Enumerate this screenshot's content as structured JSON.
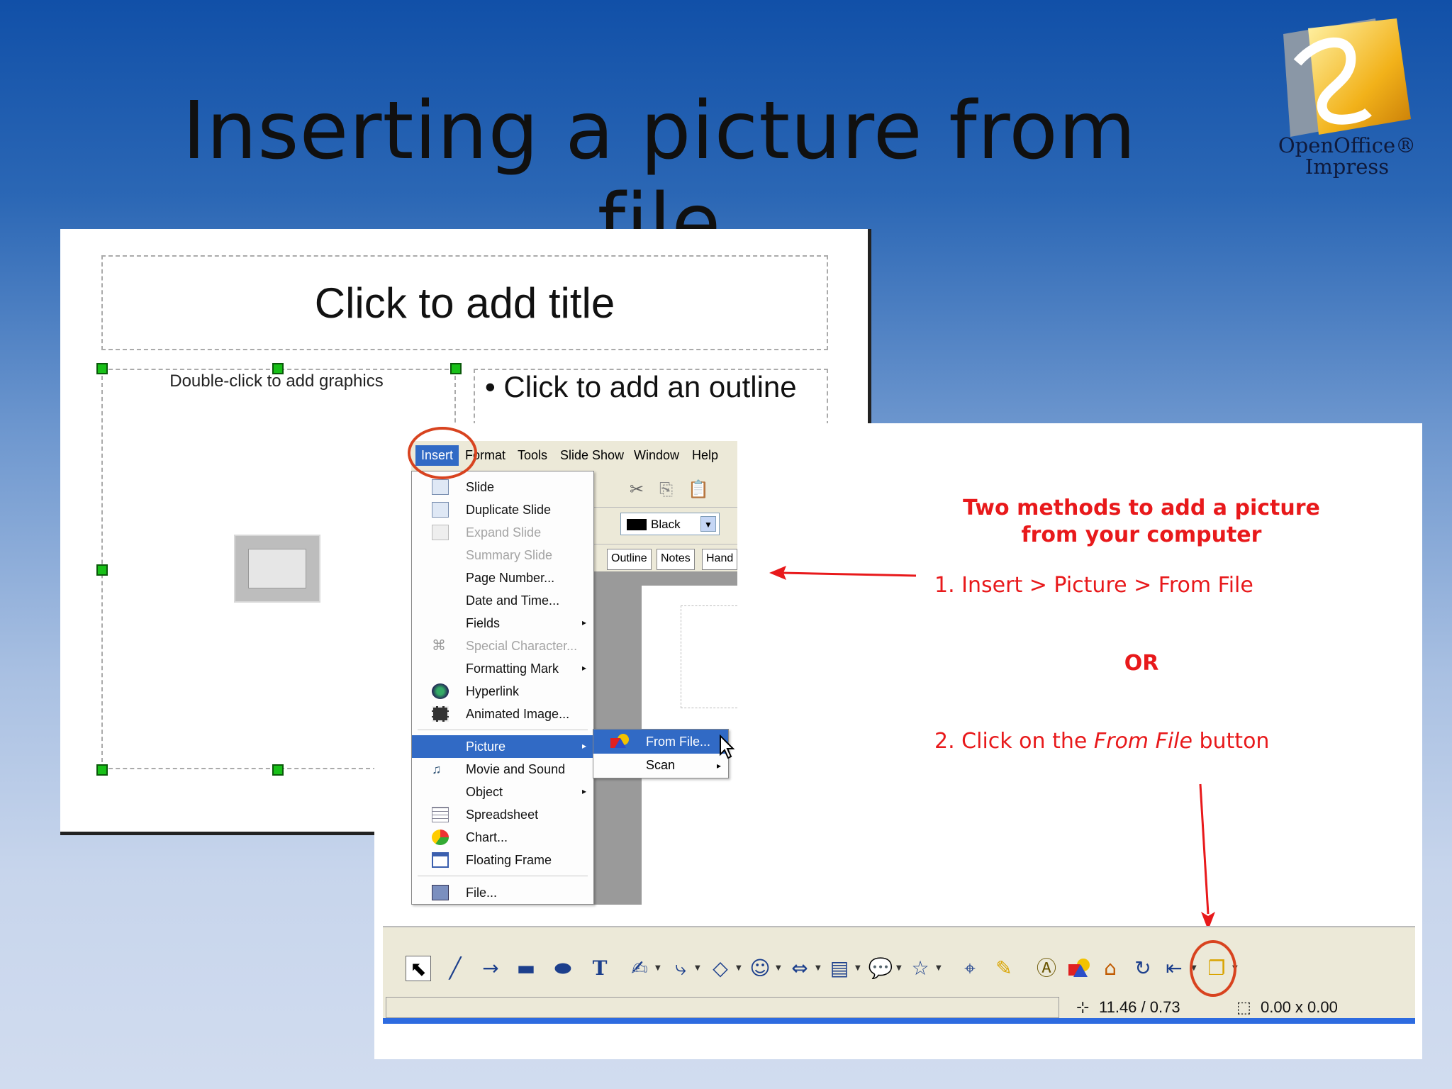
{
  "slide": {
    "title": "Inserting a picture from file",
    "logo_text": "OpenOffice®\nImpress"
  },
  "template_slide": {
    "title_placeholder": "Click to add title",
    "graphics_placeholder": "Double-click to add graphics",
    "outline_placeholder": "• Click to add an outline"
  },
  "menubar": {
    "items": [
      "Insert",
      "Format",
      "Tools",
      "Slide Show",
      "Window",
      "Help"
    ]
  },
  "toolbar": {
    "color_value": "Black",
    "view_tabs": [
      "Outline",
      "Notes",
      "Hand"
    ]
  },
  "insert_menu": {
    "items": [
      {
        "label": "Slide",
        "disabled": false
      },
      {
        "label": "Duplicate Slide",
        "disabled": false
      },
      {
        "label": "Expand Slide",
        "disabled": true
      },
      {
        "label": "Summary Slide",
        "disabled": true
      },
      {
        "label": "Page Number...",
        "disabled": false
      },
      {
        "label": "Date and Time...",
        "disabled": false
      },
      {
        "label": "Fields",
        "disabled": false,
        "submenu": true
      },
      {
        "label": "Special Character...",
        "disabled": true
      },
      {
        "label": "Formatting Mark",
        "disabled": false,
        "submenu": true
      },
      {
        "label": "Hyperlink",
        "disabled": false
      },
      {
        "label": "Animated Image...",
        "disabled": false
      },
      {
        "label": "Picture",
        "disabled": false,
        "submenu": true,
        "selected": true
      },
      {
        "label": "Movie and Sound",
        "disabled": false
      },
      {
        "label": "Object",
        "disabled": false,
        "submenu": true
      },
      {
        "label": "Spreadsheet",
        "disabled": false
      },
      {
        "label": "Chart...",
        "disabled": false
      },
      {
        "label": "Floating Frame",
        "disabled": false
      },
      {
        "label": "File...",
        "disabled": false
      }
    ]
  },
  "picture_submenu": {
    "from_file": "From File...",
    "scan": "Scan"
  },
  "instructions": {
    "heading_line1": "Two methods to add a picture",
    "heading_line2": "from your computer",
    "step1": "1.  Insert > Picture > From File",
    "or": "OR",
    "step2_prefix": "2.  Click on the ",
    "step2_em": "From File",
    "step2_suffix": " button"
  },
  "statusbar": {
    "position": "11.46 / 0.73",
    "size": "0.00 x 0.00"
  },
  "colors": {
    "accent_red": "#e8191b",
    "highlight_circle": "#d8431f",
    "menu_selection": "#316ac5"
  }
}
